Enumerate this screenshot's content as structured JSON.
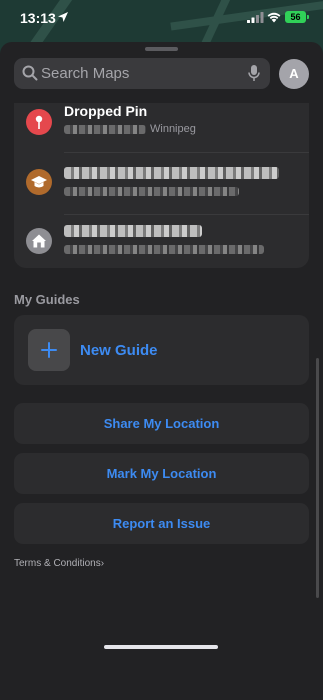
{
  "status_bar": {
    "time": "13:13",
    "battery": "56",
    "battery_color": "#30d158"
  },
  "search": {
    "placeholder": "Search Maps",
    "avatar_initial": "A"
  },
  "recents": [
    {
      "title": "Dropped Pin",
      "subtitle": "Winnipeg",
      "icon": "pin-icon",
      "icon_color": "#e5484d"
    },
    {
      "title": "",
      "subtitle": "",
      "icon": "graduation-cap-icon",
      "icon_color": "#b06a2c"
    },
    {
      "title": "",
      "subtitle": "",
      "icon": "home-icon",
      "icon_color": "#8e8e93"
    }
  ],
  "guides": {
    "section_title": "My Guides",
    "new_guide_label": "New Guide"
  },
  "actions": {
    "share_location": "Share My Location",
    "mark_location": "Mark My Location",
    "report_issue": "Report an Issue"
  },
  "footer": {
    "terms_label": "Terms & Conditions",
    "terms_chevron": "›"
  },
  "colors": {
    "accent": "#3d8bf2",
    "sheet_bg": "#222224",
    "card_bg": "#2c2c2e"
  }
}
